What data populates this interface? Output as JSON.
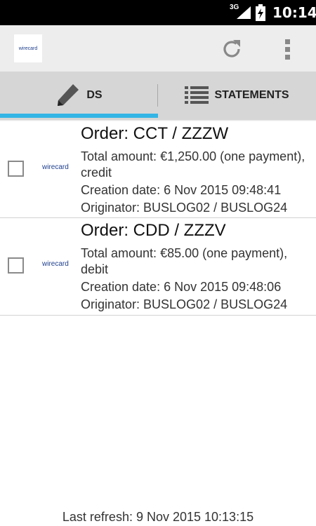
{
  "status_bar": {
    "network": "3G",
    "time": "10:14"
  },
  "action_bar": {
    "logo_text": "wirecard",
    "icons": [
      "refresh-icon",
      "overflow-menu-icon"
    ]
  },
  "tabs": [
    {
      "label": "DS",
      "icon": "pencil-icon",
      "selected": true
    },
    {
      "label": "STATEMENTS",
      "icon": "list-icon",
      "selected": false
    }
  ],
  "colors": {
    "accent": "#33b5e5",
    "tab_bg": "#d6d6d6",
    "action_bar_bg": "#ededed"
  },
  "orders": [
    {
      "logo_text": "wirecard",
      "title": "Order: CCT / ZZZW",
      "amount": "Total amount: €1,250.00 (one payment), credit",
      "created": "Creation date: 6 Nov 2015 09:48:41",
      "originator": "Originator: BUSLOG02 / BUSLOG24"
    },
    {
      "logo_text": "wirecard",
      "title": "Order: CDD / ZZZV",
      "amount": "Total amount: €85.00 (one payment), debit",
      "created": "Creation date: 6 Nov 2015 09:48:06",
      "originator": "Originator: BUSLOG02 / BUSLOG24"
    }
  ],
  "footer": {
    "last_refresh": "Last refresh: 9 Nov 2015 10:13:15"
  }
}
